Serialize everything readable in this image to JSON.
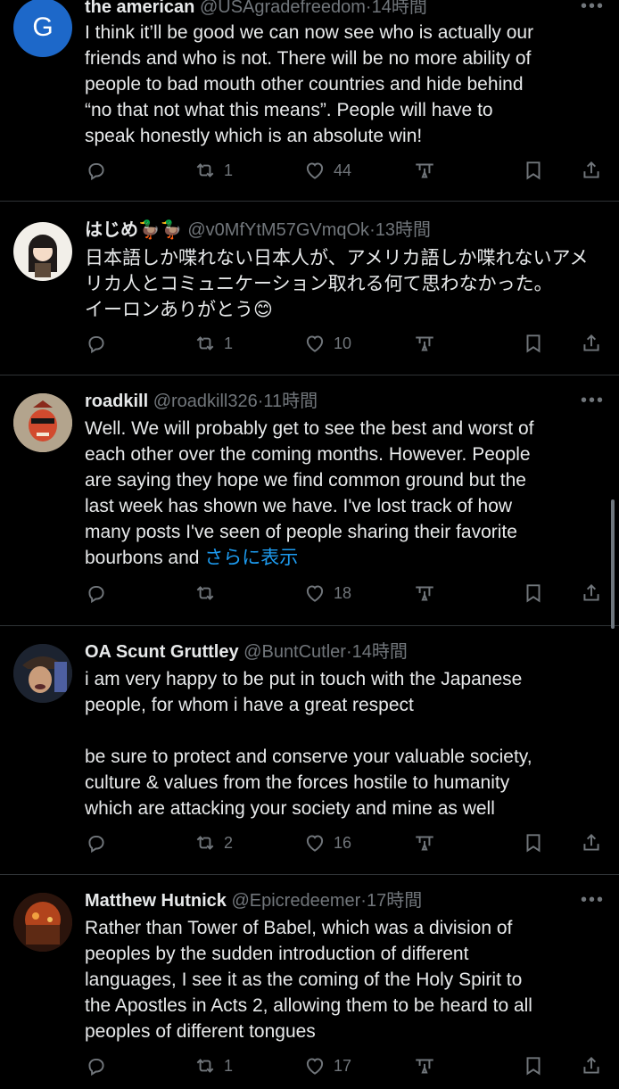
{
  "tweets": [
    {
      "avatar_letter": "G",
      "name": "the american",
      "handle": "@USAgradefreedom",
      "time": "14時間",
      "body": "I think it’ll be good we can now see who is actually our\nfriends and who is not. There will be no more ability of\npeople to bad mouth other countries and hide behind\n“no that not what this means”. People will have to\nspeak honestly which is an absolute win!",
      "show_more": "",
      "reposts": "1",
      "likes": "44"
    },
    {
      "avatar_letter": "",
      "name": "はじめ🦆🦆",
      "handle": "@v0MfYtM57GVmqOk",
      "time": "13時間",
      "body": "日本語しか喋れない日本人が、アメリカ語しか喋れないアメ\nリカ人とコミュニケーション取れる何て思わなかった。\nイーロンありがとう😊",
      "show_more": "",
      "reposts": "1",
      "likes": "10"
    },
    {
      "avatar_letter": "",
      "name": "roadkill",
      "handle": "@roadkill326",
      "time": "11時間",
      "body": "Well. We will probably get to see the best and worst of\neach other over the coming months. However. People\nare saying they hope we find common ground but the\nlast week has shown we have. I've lost track of how\nmany posts I've seen of people sharing their favorite\nbourbons and ",
      "show_more": "さらに表示",
      "reposts": "",
      "likes": "18"
    },
    {
      "avatar_letter": "",
      "name": "OA Scunt Gruttley",
      "handle": "@BuntCutler",
      "time": "14時間",
      "body": "i am very happy to be put in touch with the Japanese\npeople, for whom i have a great respect\n\nbe sure to protect and conserve your valuable society,\nculture & values from the forces hostile to humanity\nwhich are attacking your society and mine as well",
      "show_more": "",
      "reposts": "2",
      "likes": "16"
    },
    {
      "avatar_letter": "",
      "name": "Matthew Hutnick",
      "handle": "@Epicredeemer",
      "time": "17時間",
      "body": "Rather than Tower of Babel, which was a division of\npeoples by the sudden introduction of different\nlanguages, I see it as the coming of the Holy Spirit to\nthe Apostles in Acts 2, allowing them to be heard to all\npeoples of different tongues",
      "show_more": "",
      "reposts": "1",
      "likes": "17"
    }
  ],
  "dot_separator": "·",
  "more_glyph": "•••",
  "colors": {
    "background": "#000000",
    "text": "#e7e9ea",
    "muted": "#71767b",
    "link": "#1d9bf0",
    "divider": "#2f3336"
  }
}
